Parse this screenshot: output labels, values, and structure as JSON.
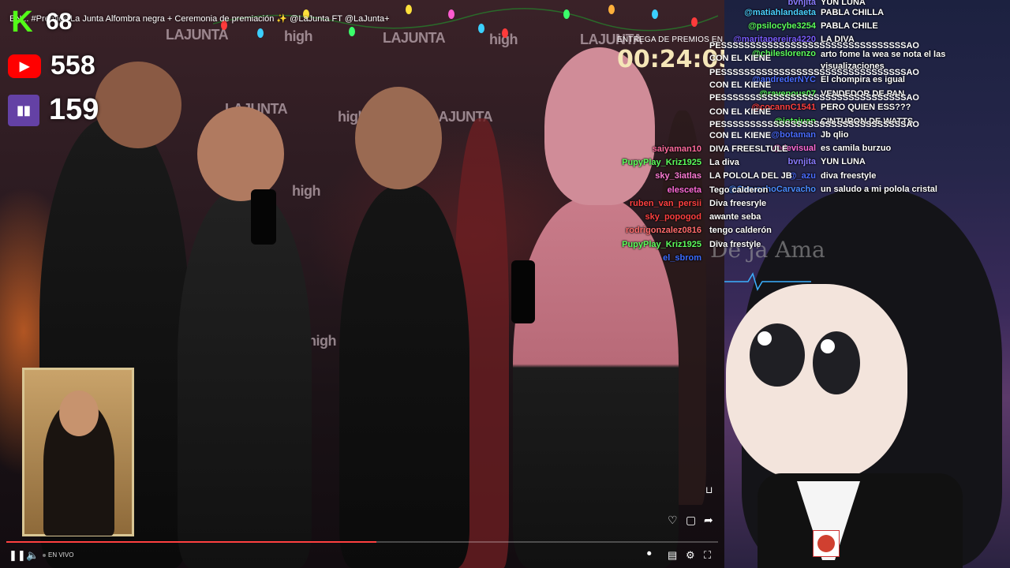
{
  "video": {
    "title": "EN VIVO: Premios La Junta Alfombra negra + Ceremonia de premiación ✨ @LaJunta FT @LaJunta+",
    "title_visible": "EN... #Premios La Junta Alfombra negra + Ceremonia de premiación ✨ @LaJunta FT @LaJunta+",
    "backdrop_logos": [
      "LAJUNTA",
      "high",
      "LAJUNTA",
      "high",
      "LAJUNTA",
      "high",
      "high",
      "LAJUNTA",
      "high",
      "high"
    ]
  },
  "stats": [
    {
      "platform": "kick",
      "icon": "kick-icon",
      "value": "68",
      "color": "#53fc18"
    },
    {
      "platform": "youtube",
      "icon": "youtube-icon",
      "value": "558",
      "color": "#ff0000"
    },
    {
      "platform": "twitch",
      "icon": "twitch-icon",
      "value": "159",
      "color": "#6441a5"
    }
  ],
  "countdown": {
    "label": "ENTREGA DE PREMIOS EN",
    "time": "00:24:05"
  },
  "left_chat": [
    {
      "user": "saiyaman10",
      "msg": "DIVA FREESLTULE",
      "user_color": "#ff6b9d"
    },
    {
      "user": "PupyPlay_Kriz1925",
      "msg": "La diva",
      "user_color": "#5cff5c"
    },
    {
      "user": "sky_3iatlas",
      "msg": "LA POLOLA DEL JB",
      "user_color": "#ff7bd5"
    },
    {
      "user": "elesceta",
      "msg": "Tego calderon",
      "user_color": "#ff6bd8"
    },
    {
      "user": "ruben_van_persii",
      "msg": "Diva freesryle",
      "user_color": "#ff4040"
    },
    {
      "user": "sky_popogod",
      "msg": "awante seba",
      "user_color": "#ff4040"
    },
    {
      "user": "rodrigonzalez0816",
      "msg": "tengo calderón",
      "user_color": "#ff6b6b"
    },
    {
      "user": "PupyPlay_Kriz1925",
      "msg": "Diva frestyle",
      "user_color": "#5cff5c"
    },
    {
      "user": "el_sbrom",
      "msg": "",
      "user_color": "#3b6cff"
    }
  ],
  "spam_lines": [
    "PESSSSSSSSSSSSSSSSSSSSSSSSSSSSSSSSAO",
    "CON EL KIENE",
    "PESSSSSSSSSSSSSSSSSSSSSSSSSSSSSSSSAO",
    "CON EL KIENE",
    "PESSSSSSSSSSSSSSSSSSSSSSSSSSSSSSSSAO",
    "CON EL KIENE",
    "PESSSSSSSSSSSSSSSSSSSSSSSSSSSSSSSSAO",
    "CON EL KIENE"
  ],
  "right_chat": [
    {
      "user": "bvnjita",
      "msg": "YUN LUNA",
      "user_color": "#8a7bff"
    },
    {
      "user": "@matiahlandaeta",
      "msg": "PABLA CHILLA",
      "user_color": "#4ad0ff"
    },
    {
      "user": "@psilocybe3254",
      "msg": "PABLA CHILE",
      "user_color": "#5cff5c"
    },
    {
      "user": "@maritapereira4220",
      "msg": "LA DIVA",
      "user_color": "#7a5cff"
    },
    {
      "user": "@chileslorenzo",
      "msg": "arto fome la wea se nota el las visualizaciones",
      "user_color": "#5cff5c"
    },
    {
      "user": "@andrederNYC",
      "msg": "El chompira es igual",
      "user_color": "#4a6cff"
    },
    {
      "user": "@ravenous07",
      "msg": "VENDEDOR DE PAN",
      "user_color": "#5cff5c"
    },
    {
      "user": "@cocannC1541",
      "msg": "PERO QUIEN ESS???",
      "user_color": "#ff4040"
    },
    {
      "user": "@jotajuan",
      "msg": "CINTURON DE WATTS",
      "user_color": "#5cff5c"
    },
    {
      "user": "@botaman",
      "msg": "Jb qlio",
      "user_color": "#4a6cff"
    },
    {
      "user": "@devisual",
      "msg": "es camila burzuo",
      "user_color": "#ff6bd8"
    },
    {
      "user": "bvnjita",
      "msg": "YUN LUNA",
      "user_color": "#8a7bff"
    },
    {
      "user": "@_azu",
      "msg": "diva freestyle",
      "user_color": "#4a6cff"
    },
    {
      "user": "@CarvachoCarvacho",
      "msg": "un saludo a mi pololа cristal",
      "user_color": "#4a8cff"
    }
  ],
  "avatar_overlay": {
    "script_text": "De ja Ama"
  },
  "player": {
    "live_label": "EN VIVO",
    "progress": 0.52,
    "accent": "#ff4040"
  }
}
